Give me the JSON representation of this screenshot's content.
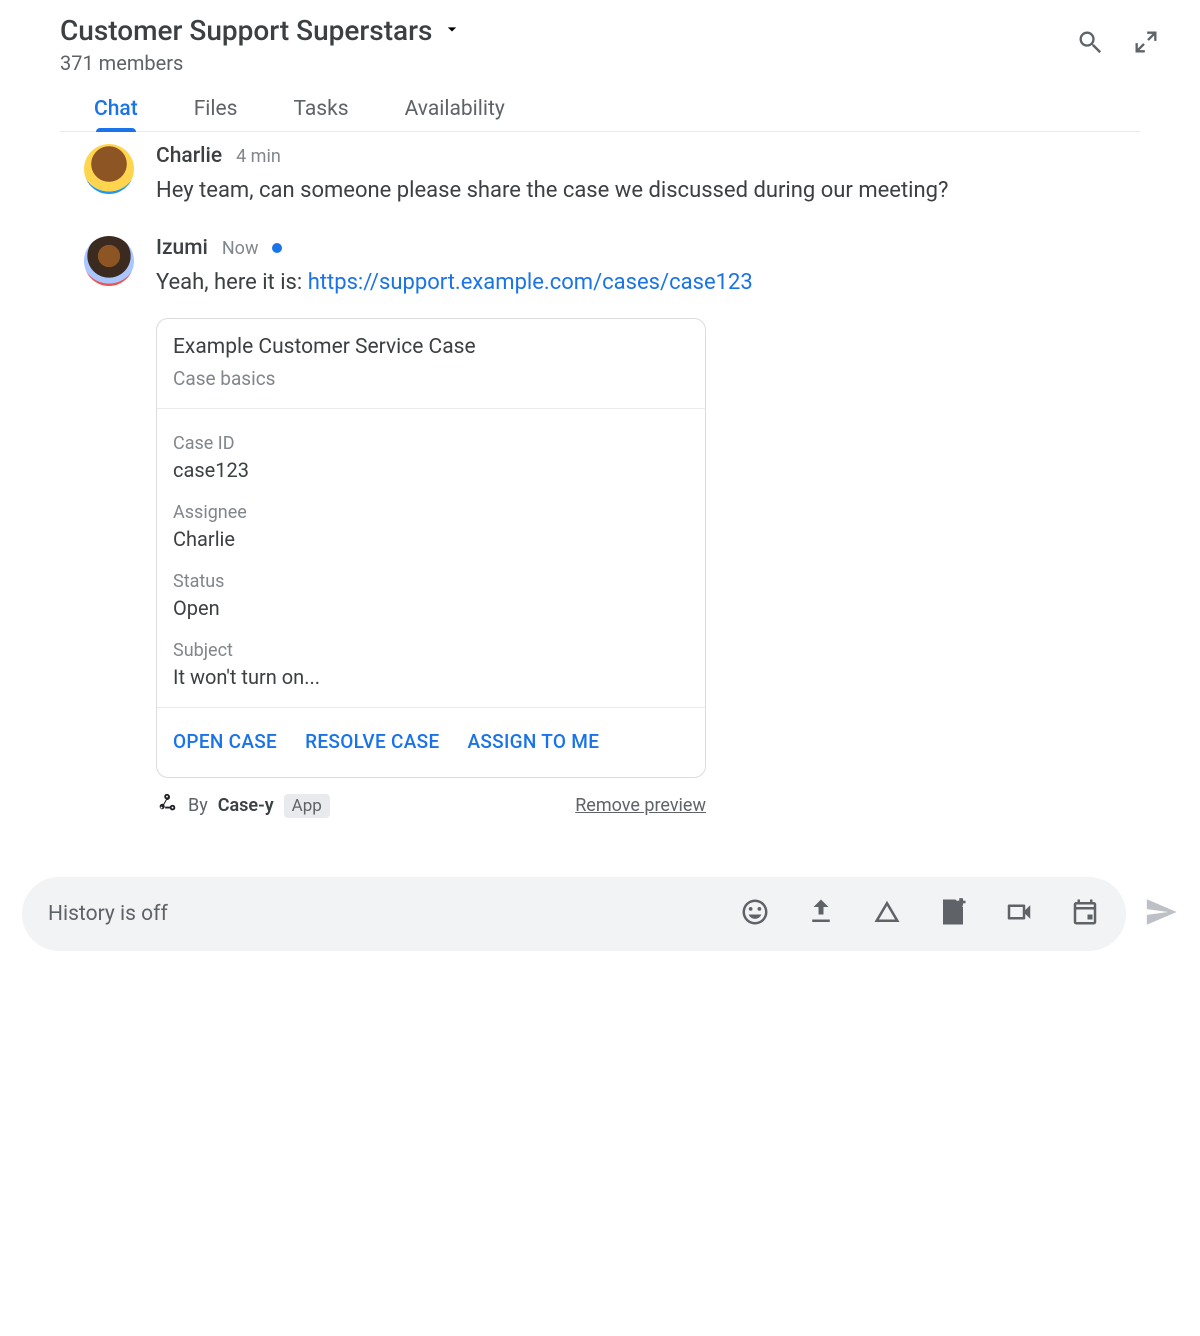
{
  "header": {
    "room_title": "Customer Support Superstars",
    "members": "371 members"
  },
  "tabs": [
    {
      "label": "Chat",
      "active": true
    },
    {
      "label": "Files",
      "active": false
    },
    {
      "label": "Tasks",
      "active": false
    },
    {
      "label": "Availability",
      "active": false
    }
  ],
  "messages": [
    {
      "author": "Charlie",
      "time": "4 min",
      "text": "Hey team, can someone please share the case we discussed during our meeting?",
      "avatar": "charlie"
    },
    {
      "author": "Izumi",
      "time": "Now",
      "status_dot": true,
      "text_prefix": "Yeah, here it is: ",
      "link_text": "https://support.example.com/cases/case123",
      "avatar": "izumi",
      "card": {
        "title": "Example Customer Service Case",
        "subtitle": "Case basics",
        "fields": [
          {
            "label": "Case ID",
            "value": "case123"
          },
          {
            "label": "Assignee",
            "value": "Charlie"
          },
          {
            "label": "Status",
            "value": "Open"
          },
          {
            "label": "Subject",
            "value": "It won't turn on..."
          }
        ],
        "actions": [
          "OPEN CASE",
          "RESOLVE CASE",
          "ASSIGN TO ME"
        ]
      },
      "preview_footer": {
        "by_prefix": "By ",
        "app_name": "Case-y",
        "badge": "App",
        "remove": "Remove preview"
      }
    }
  ],
  "composer": {
    "placeholder": "History is off"
  }
}
